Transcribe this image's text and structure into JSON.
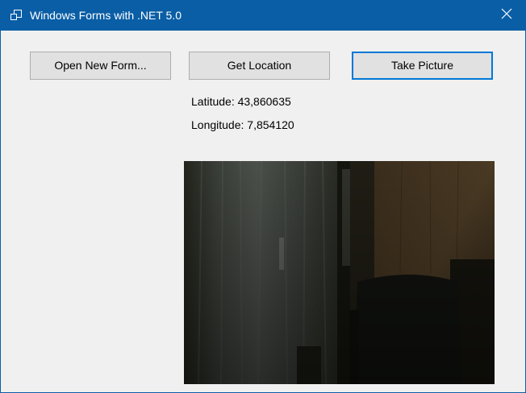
{
  "window": {
    "title": "Windows Forms with .NET 5.0",
    "icons": {
      "app": "windows-forms-app-icon",
      "close": "close-icon"
    },
    "colors": {
      "titlebar": "#0a5ea6",
      "client_background": "#f0f0f0",
      "focus_border": "#0078d7"
    }
  },
  "buttons": {
    "open_new_form": "Open New Form...",
    "get_location": "Get Location",
    "take_picture": "Take Picture"
  },
  "location": {
    "latitude_label": "Latitude: 43,860635",
    "longitude_label": "Longitude: 7,854120"
  }
}
